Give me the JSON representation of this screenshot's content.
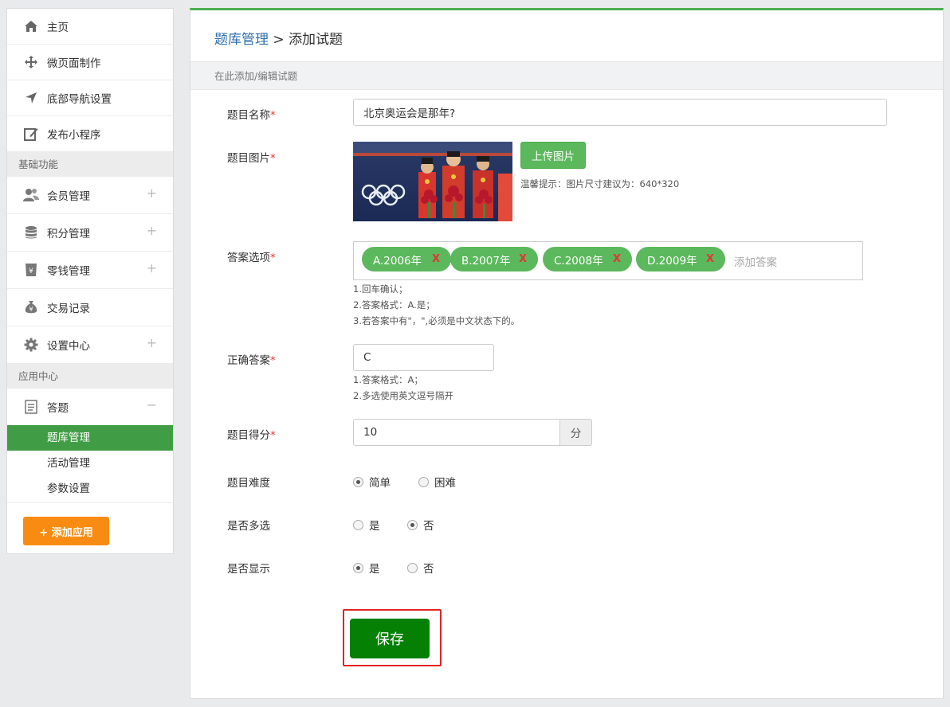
{
  "sidebar": {
    "top_items": [
      {
        "label": "主页",
        "icon": "home-icon"
      },
      {
        "label": "微页面制作",
        "icon": "move-icon"
      },
      {
        "label": "底部导航设置",
        "icon": "navigation-arrow-icon"
      },
      {
        "label": "发布小程序",
        "icon": "edit-icon"
      }
    ],
    "section_basic": "基础功能",
    "basic_items": [
      {
        "label": "会员管理",
        "icon": "users-icon",
        "toggle": "+"
      },
      {
        "label": "积分管理",
        "icon": "database-icon",
        "toggle": "+"
      },
      {
        "label": "零钱管理",
        "icon": "yen-cup-icon",
        "toggle": "+"
      },
      {
        "label": "交易记录",
        "icon": "money-bag-icon",
        "toggle": ""
      },
      {
        "label": "设置中心",
        "icon": "gear-icon",
        "toggle": "+"
      }
    ],
    "section_apps": "应用中心",
    "app_group": {
      "label": "答题",
      "icon": "document-icon",
      "toggle": "−"
    },
    "sub_items": [
      {
        "label": "题库管理",
        "active": true
      },
      {
        "label": "活动管理",
        "active": false
      },
      {
        "label": "参数设置",
        "active": false
      }
    ],
    "add_app_label": "+ 添加应用"
  },
  "header": {
    "breadcrumb_link": "题库管理",
    "breadcrumb_sep": " > ",
    "breadcrumb_current": "添加试题",
    "subtitle": "在此添加/编辑试题"
  },
  "form": {
    "title_label": "题目名称",
    "title_value": "北京奥运会是那年?",
    "image_label": "题目图片",
    "upload_label": "上传图片",
    "image_hint": "温馨提示：图片尺寸建议为：640*320",
    "answers_label": "答案选项",
    "answers": [
      "A.2006年",
      "B.2007年",
      "C.2008年",
      "D.2009年"
    ],
    "remove_glyph": "X",
    "answer_placeholder": "添加答案",
    "answers_help": [
      "1.回车确认；",
      "2.答案格式：A.是；",
      "3.若答案中有\"，\",必须是中文状态下的。"
    ],
    "correct_label": "正确答案",
    "correct_value": "C",
    "correct_help": [
      "1.答案格式：A；",
      "2.多选使用英文逗号隔开"
    ],
    "score_label": "题目得分",
    "score_value": "10",
    "score_unit": "分",
    "difficulty_label": "题目难度",
    "difficulty_options": [
      "简单",
      "困难"
    ],
    "difficulty_selected": "简单",
    "multi_label": "是否多选",
    "multi_options": [
      "是",
      "否"
    ],
    "multi_selected": "否",
    "show_label": "是否显示",
    "show_options": [
      "是",
      "否"
    ],
    "show_selected": "是",
    "required_mark": "*",
    "save_label": "保存"
  },
  "colors": {
    "accent_green": "#419d45",
    "tag_green": "#5cb85c",
    "save_green": "#058005",
    "add_app_orange": "#f88c12",
    "highlight_red": "#e02424",
    "link_blue": "#2f6eab"
  }
}
